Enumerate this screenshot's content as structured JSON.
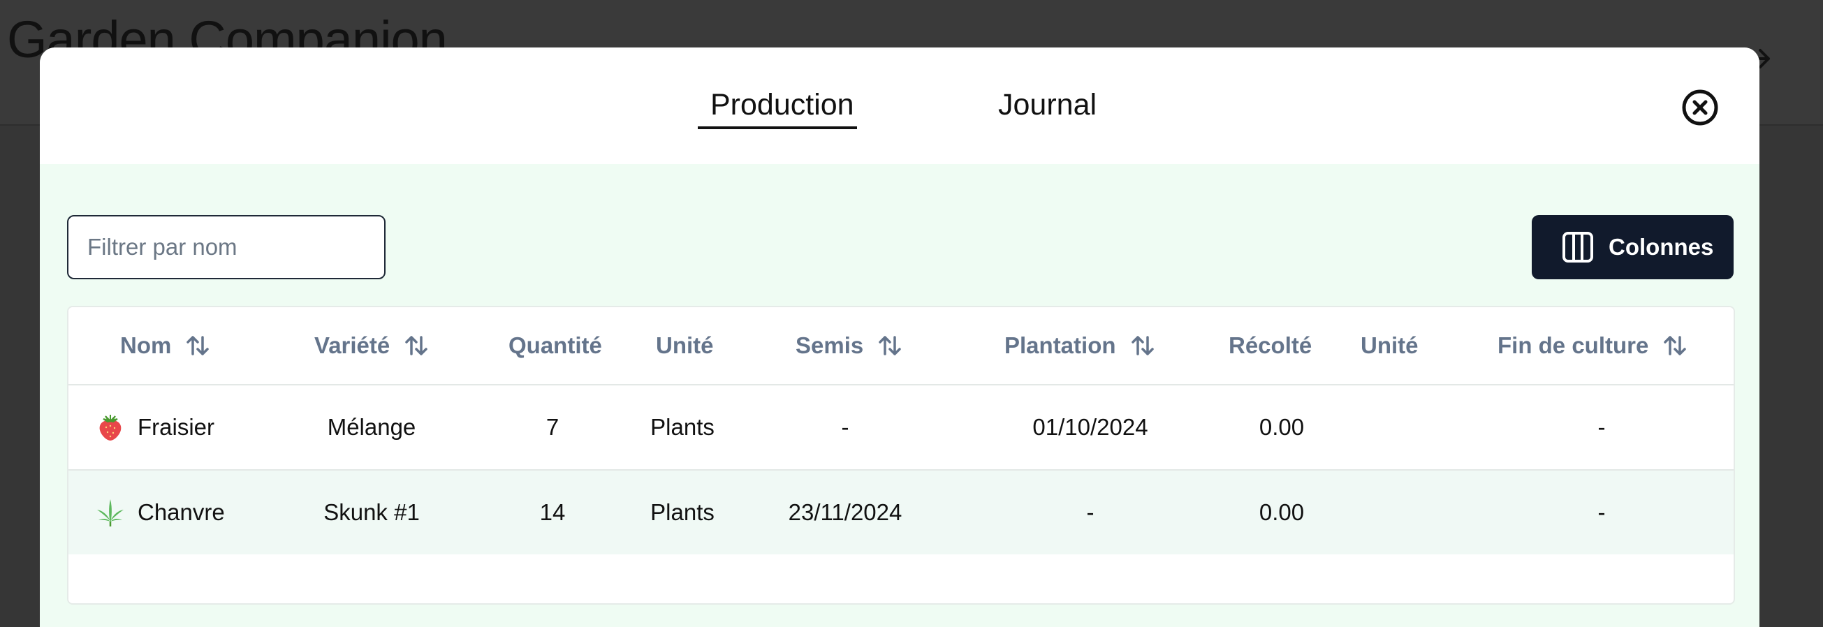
{
  "app": {
    "title": "Garden Companion"
  },
  "modal": {
    "tabs": [
      {
        "label": "Production",
        "active": true
      },
      {
        "label": "Journal",
        "active": false
      }
    ]
  },
  "toolbar": {
    "filter_placeholder": "Filtrer par nom",
    "filter_value": "",
    "columns_label": "Colonnes"
  },
  "table": {
    "headers": {
      "nom": "Nom",
      "variete": "Variété",
      "quantite": "Quantité",
      "unite": "Unité",
      "semis": "Semis",
      "plantation": "Plantation",
      "recolte": "Récolté",
      "unite2": "Unité",
      "fin": "Fin de culture"
    },
    "rows": [
      {
        "icon": "strawberry-icon",
        "nom": "Fraisier",
        "variete": "Mélange",
        "quantite": "7",
        "unite": "Plants",
        "semis": "-",
        "plantation": "01/10/2024",
        "recolte": "0.00",
        "unite2": "",
        "fin": "-"
      },
      {
        "icon": "cannabis-leaf-icon",
        "nom": "Chanvre",
        "variete": "Skunk #1",
        "quantite": "14",
        "unite": "Plants",
        "semis": "23/11/2024",
        "plantation": "-",
        "recolte": "0.00",
        "unite2": "",
        "fin": "-"
      }
    ]
  },
  "colors": {
    "backdrop": "#363636",
    "modal_body": "#effcf3",
    "button_dark": "#111a2c",
    "header_text": "#64748b",
    "striped_row": "#f0f9f5"
  }
}
